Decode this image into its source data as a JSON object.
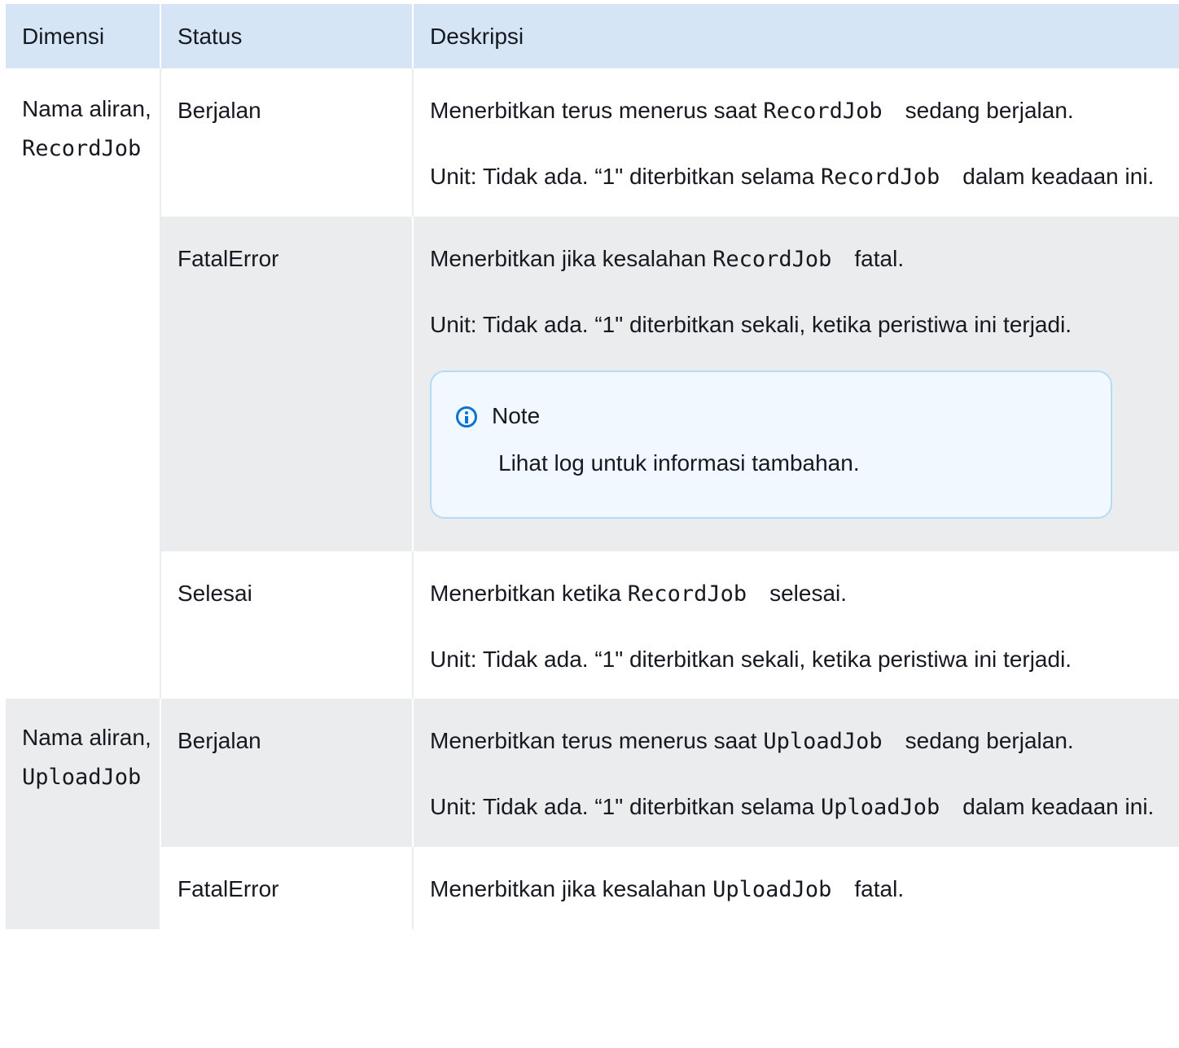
{
  "headers": {
    "dimension": "Dimensi",
    "status": "Status",
    "description": "Deskripsi"
  },
  "groups": [
    {
      "dimension_text": "Nama aliran,",
      "dimension_code": "RecordJob",
      "rows": [
        {
          "status": "Berjalan",
          "desc_pre": "Menerbitkan terus menerus saat ",
          "desc_code": "RecordJob",
          "desc_post": "sedang berjalan.",
          "unit_pre": "Unit: Tidak ada. “1\" diterbitkan selama ",
          "unit_code": "RecordJob",
          "unit_post": "dalam keadaan ini."
        },
        {
          "status": "FatalError",
          "desc_pre": "Menerbitkan jika kesalahan ",
          "desc_code": "RecordJob",
          "desc_post": "fatal.",
          "unit": "Unit: Tidak ada. “1\" diterbitkan sekali, ketika peristiwa ini terjadi.",
          "note_title": "Note",
          "note_text": "Lihat log untuk informasi tambahan."
        },
        {
          "status": "Selesai",
          "desc_pre": "Menerbitkan ketika ",
          "desc_code": "RecordJob",
          "desc_post": "selesai.",
          "unit": "Unit: Tidak ada. “1\" diterbitkan sekali, ketika peristiwa ini terjadi."
        }
      ]
    },
    {
      "dimension_text": "Nama aliran,",
      "dimension_code": "UploadJob",
      "rows": [
        {
          "status": "Berjalan",
          "desc_pre": "Menerbitkan terus menerus saat ",
          "desc_code": "UploadJob",
          "desc_post": "sedang berjalan.",
          "unit_pre": "Unit: Tidak ada. “1\" diterbitkan selama ",
          "unit_code": "UploadJob",
          "unit_post": "dalam keadaan ini."
        },
        {
          "status": "FatalError",
          "desc_pre": "Menerbitkan jika kesalahan ",
          "desc_code": "UploadJob",
          "desc_post": "fatal."
        }
      ]
    }
  ]
}
